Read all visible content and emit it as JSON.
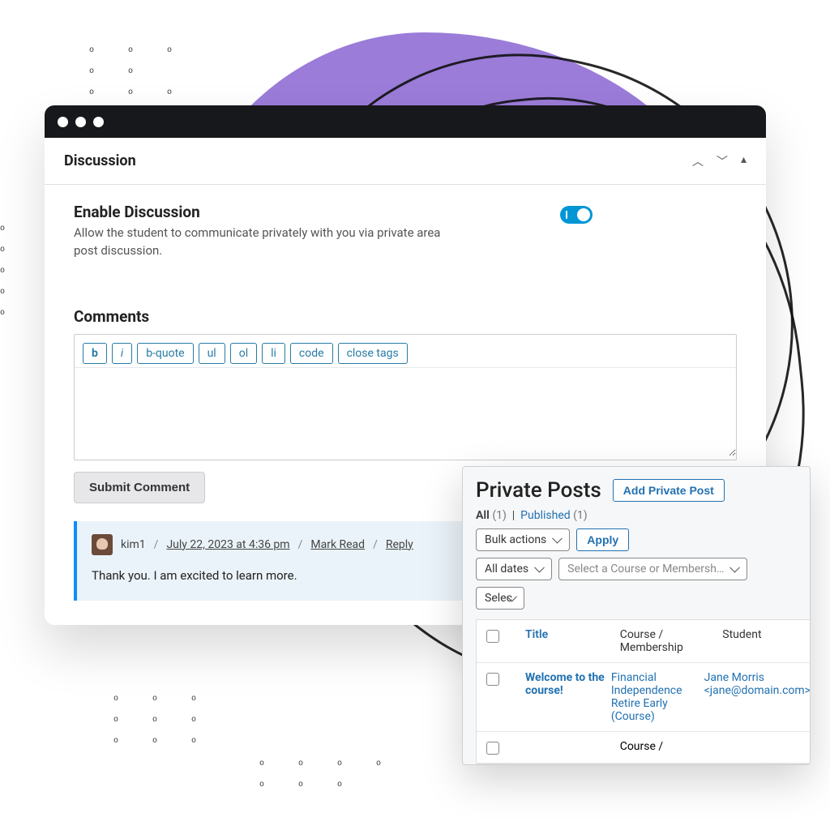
{
  "discussion_panel": {
    "title": "Discussion",
    "enable": {
      "heading": "Enable Discussion",
      "description": "Allow the student to communicate privately with you via private area post discussion.",
      "on": true
    },
    "comments_heading": "Comments",
    "quicktags": [
      "b",
      "i",
      "b-quote",
      "ul",
      "ol",
      "li",
      "code",
      "close tags"
    ],
    "submit_label": "Submit Comment",
    "comment": {
      "author": "kim1",
      "timestamp": "July 22, 2023 at 4:36 pm",
      "mark_read_label": "Mark Read",
      "reply_label": "Reply",
      "body": "Thank you. I am excited to learn more."
    }
  },
  "private_posts": {
    "title": "Private Posts",
    "add_button": "Add Private Post",
    "filters": {
      "all_label": "All",
      "all_count": "(1)",
      "published_label": "Published",
      "published_count": "(1)"
    },
    "bulk_actions": "Bulk actions",
    "apply_label": "Apply",
    "all_dates": "All dates",
    "course_filter_placeholder": "Select a Course or Membersh…",
    "select_trunc": "Selec",
    "columns": {
      "title": "Title",
      "course": "Course / Membership",
      "student": "Student"
    },
    "rows": [
      {
        "title": "Welcome to the course!",
        "course": "Financial Independence Retire Early (Course)",
        "student": "Jane Morris <jane@domain.com>"
      }
    ],
    "footer_course": "Course /"
  }
}
